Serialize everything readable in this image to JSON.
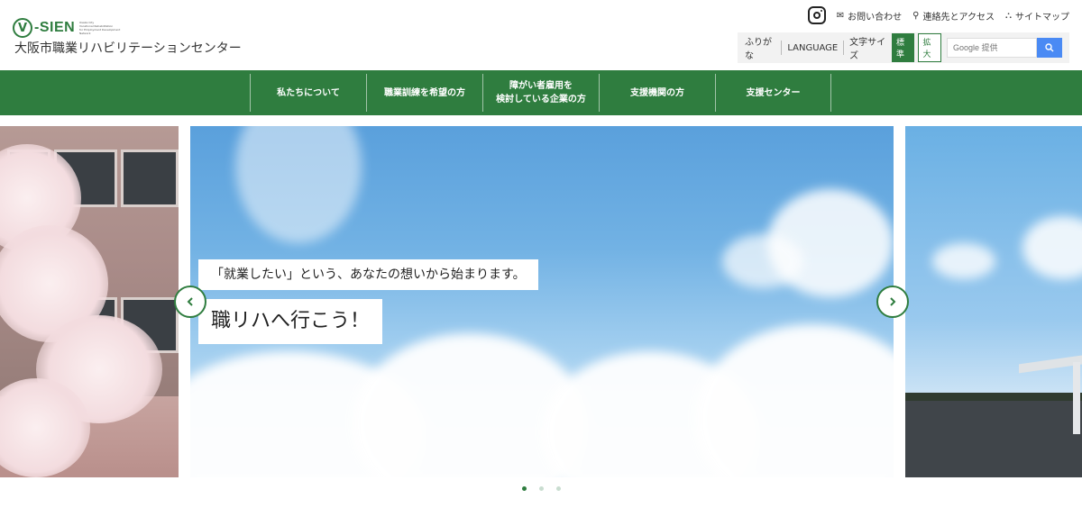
{
  "header": {
    "logo_word": "-SIEN",
    "logo_letter": "V",
    "logo_small_lines": [
      "Osaka City",
      "Vocational Rehabilitation",
      "for Employment Development",
      "Network"
    ],
    "site_name": "大阪市職業リハビリテーションセンター"
  },
  "util_links": {
    "instagram_icon": "instagram-icon",
    "contact": "お問い合わせ",
    "access": "連絡先とアクセス",
    "sitemap": "サイトマップ"
  },
  "tools": {
    "furigana": "ふりがな",
    "language": "LANGUAGE",
    "font_size_label": "文字サイズ",
    "size_standard": "標準",
    "size_large": "拡大",
    "search_placeholder": "Google 提供"
  },
  "nav": {
    "items": [
      {
        "label": "私たちについて"
      },
      {
        "label": "職業訓練を希望の方"
      },
      {
        "label_line1": "障がい者雇用を",
        "label_line2": "検討している企業の方"
      },
      {
        "label": "支援機関の方"
      },
      {
        "label": "支援センター"
      }
    ]
  },
  "hero": {
    "subtitle": "「就業したい」という、あなたの想いから始まります。",
    "title": "職リハへ行こう！"
  },
  "colors": {
    "brand_green": "#2f7d3f",
    "search_blue": "#4a8af4"
  },
  "slider": {
    "dot_count": 3,
    "active_index": 0
  }
}
